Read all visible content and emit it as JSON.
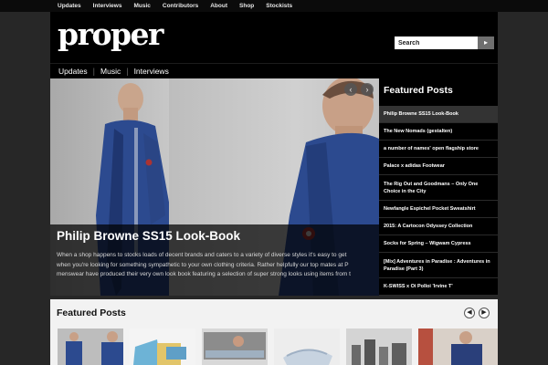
{
  "topnav": [
    "Updates",
    "Interviews",
    "Music",
    "Contributors",
    "About",
    "Shop",
    "Stockists"
  ],
  "logo": "proper",
  "search": {
    "placeholder": "Search",
    "value": "Search",
    "button_icon": "arrow-right-icon"
  },
  "mainnav": [
    "Updates",
    "Music",
    "Interviews"
  ],
  "slider": {
    "title": "Philip Browne SS15 Look-Book",
    "text_lines": [
      "When a shop happens to stocks loads of decent brands and caters to a variety of diverse styles it's easy to get",
      "when you're looking for something sympathetic to your own clothing criteria. Rather helpfully our top mates at P",
      "menswear have produced their very own look book featuring a selection of super strong looks using items from t"
    ],
    "prev_icon": "chevron-left-icon",
    "next_icon": "chevron-right-icon"
  },
  "sidebar": {
    "title": "Featured Posts",
    "items": [
      "Philip Browne SS15 Look-Book",
      "The New Nomads (gestalten)",
      "a number of names' open flagship store",
      "Palace x adidas Footwear",
      "The Rig Out and Goodmans – Only One Choice in the City",
      "Newfangle Espichel Pocket Sweatshirt",
      "2015: A Cartocon Odyssey Collection",
      "Socks for Spring – Wigwam Cypress",
      "[Mix] Adventures in Paradise : Adventures in Paradise (Part 3)",
      "K-SWISS x Oi Polloi 'Irvine T'"
    ]
  },
  "bottom": {
    "title": "Featured Posts",
    "prev_icon": "chevron-left-icon",
    "next_icon": "chevron-right-icon"
  },
  "colors": {
    "accent_jacket": "#2c4a8f",
    "header_bg": "#000000",
    "page_bg": "#272727"
  }
}
